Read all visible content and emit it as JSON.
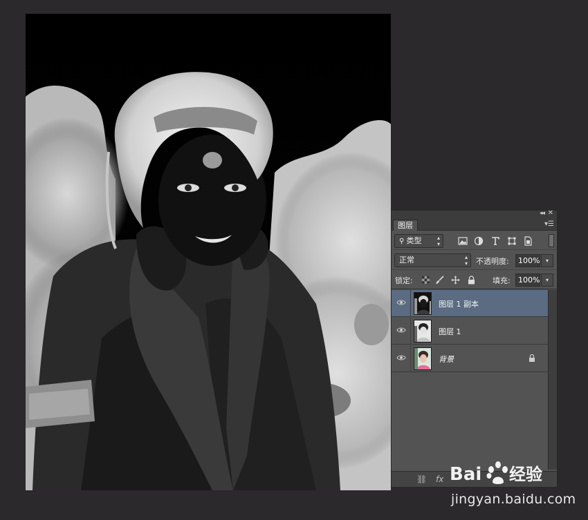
{
  "panel": {
    "tab_label": "图层",
    "filter": {
      "kind_label": "类型"
    },
    "blend_mode": "正常",
    "opacity_label": "不透明度:",
    "opacity_value": "100%",
    "lock_label": "锁定:",
    "fill_label": "填充:",
    "fill_value": "100%",
    "layers": [
      {
        "name": "图层 1 副本",
        "selected": true
      },
      {
        "name": "图层 1",
        "selected": false
      },
      {
        "name": "背景",
        "selected": false,
        "locked": true
      }
    ]
  },
  "watermark": {
    "logo_text": "Bai 经验",
    "url": "jingyan.baidu.com"
  },
  "colors": {
    "background": "#2b292c",
    "panel": "#535353",
    "selected_layer": "#5a6b82"
  }
}
